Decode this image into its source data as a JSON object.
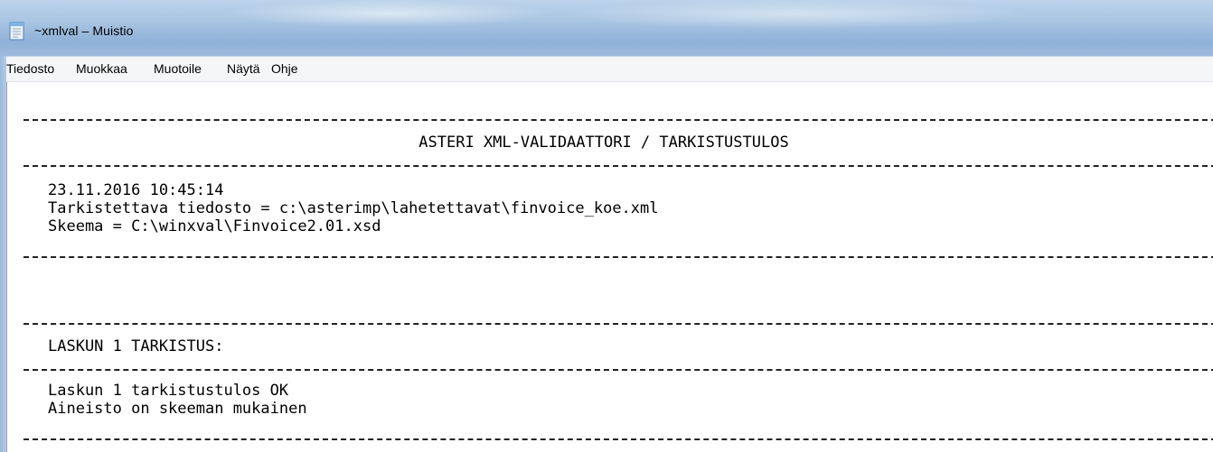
{
  "window": {
    "title": "~xmlval – Muistio",
    "app_icon": "notepad-icon"
  },
  "menu": {
    "items": [
      "Tiedosto",
      "Muokkaa",
      "Muotoile",
      "Näytä",
      "Ohje"
    ]
  },
  "document": {
    "header_title": "ASTERI XML-VALIDAATTORI / TARKISTUSTULOS",
    "timestamp": "23.11.2016 10:45:14",
    "checked_file": "Tarkistettava tiedosto = c:\\asterimp\\lahetettavat\\finvoice_koe.xml",
    "schema": "Skeema = C:\\winxval\\Finvoice2.01.xsd",
    "invoice_check_title": "LASKUN 1 TARKISTUS:",
    "invoice_result": "Laskun 1 tarkistustulos OK",
    "schema_result": "Aineisto on skeeman mukainen"
  }
}
